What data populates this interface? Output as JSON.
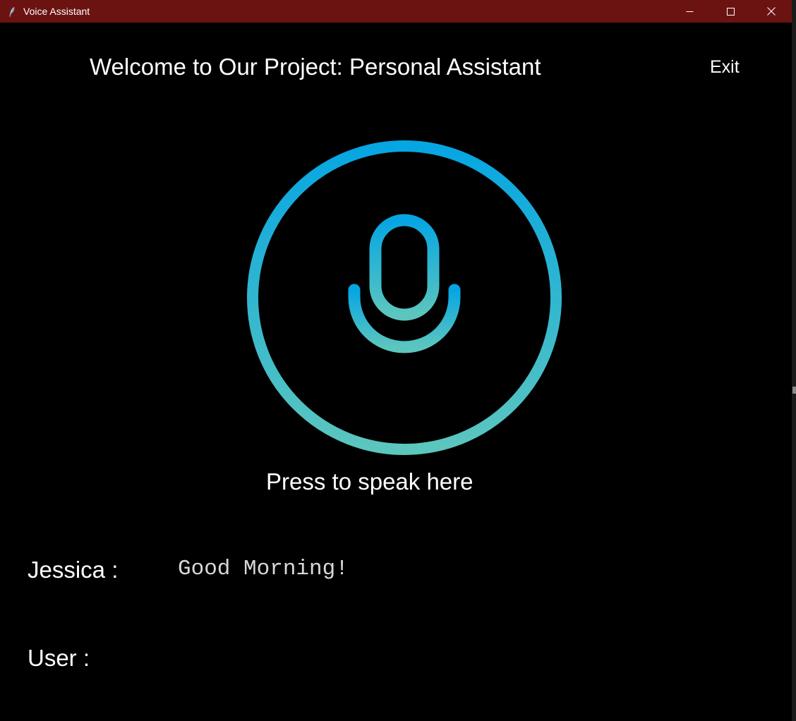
{
  "window": {
    "title": "Voice Assistant",
    "titlebar_color": "#6b1311",
    "app_icon": "feather-icon",
    "controls": [
      "minimize-icon",
      "maximize-icon",
      "close-icon"
    ]
  },
  "header": {
    "welcome_text": "Welcome to Our Project: Personal Assistant",
    "exit_label": "Exit"
  },
  "mic": {
    "icon": "microphone-icon",
    "gradient_top": "#06a6e2",
    "gradient_bottom": "#5cc6be",
    "label": "Press to speak here"
  },
  "conversation": {
    "assistant_name": "Jessica :",
    "assistant_message": "Good Morning!",
    "user_name": "User :",
    "user_message": ""
  }
}
